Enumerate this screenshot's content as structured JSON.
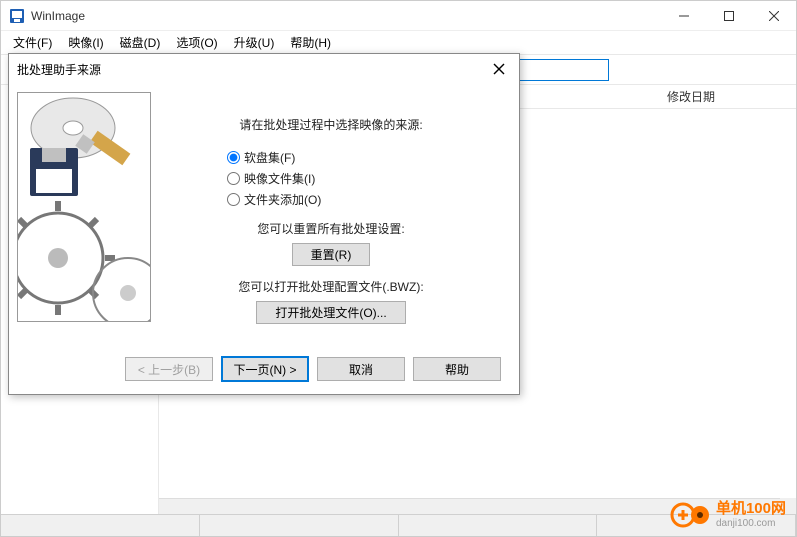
{
  "window": {
    "title": "WinImage"
  },
  "menu": {
    "file": "文件(F)",
    "image": "映像(I)",
    "disk": "磁盘(D)",
    "options": "选项(O)",
    "upgrade": "升级(U)",
    "help": "帮助(H)"
  },
  "columns": {
    "mod_date": "修改日期"
  },
  "dialog": {
    "title": "批处理助手来源",
    "heading": "请在批处理过程中选择映像的来源:",
    "radio_floppy": "软盘集(F)",
    "radio_image": "映像文件集(I)",
    "radio_folder": "文件夹添加(O)",
    "reset_label": "您可以重置所有批处理设置:",
    "reset_btn": "重置(R)",
    "open_label": "您可以打开批处理配置文件(.BWZ):",
    "open_btn": "打开批处理文件(O)...",
    "back": "< 上一步(B)",
    "next": "下一页(N) >",
    "cancel": "取消",
    "help": "帮助"
  },
  "watermark": {
    "cn": "单机100网",
    "en": "danji100.com"
  }
}
